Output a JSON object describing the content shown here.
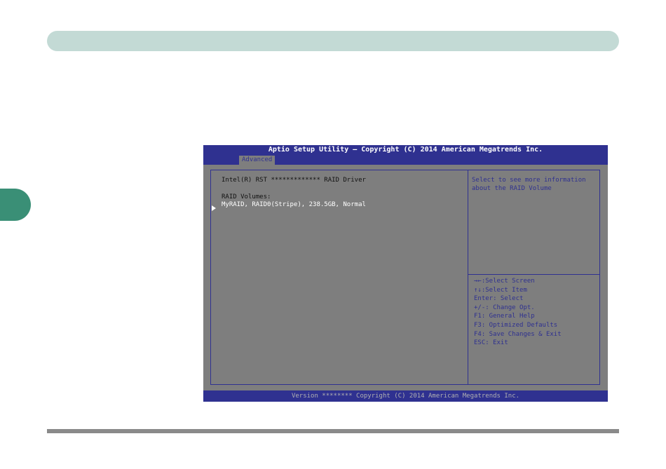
{
  "bios": {
    "title": "Aptio Setup Utility – Copyright (C) 2014 American Megatrends Inc.",
    "tabs": [
      "Advanced"
    ],
    "main": {
      "driver": "Intel(R) RST ************* RAID Driver",
      "raid_volumes_label": "RAID Volumes:",
      "volume": "MyRAID, RAID0(Stripe), 238.5GB, Normal"
    },
    "help": "Select to see more information about the RAID Volume",
    "keys": [
      "→←:Select Screen",
      "↑↓:Select Item",
      "Enter: Select",
      "+/-: Change Opt.",
      "F1: General Help",
      "F3: Optimized Defaults",
      "F4: Save Changes & Exit",
      "ESC: Exit"
    ],
    "footer": "Version ******** Copyright (C) 2014 American Megatrends Inc."
  },
  "colors": {
    "bios_blue": "#2f3190",
    "bios_gray": "#7e7e7e",
    "page_band": "#c3dad5",
    "side_tab": "#3a8f76"
  }
}
